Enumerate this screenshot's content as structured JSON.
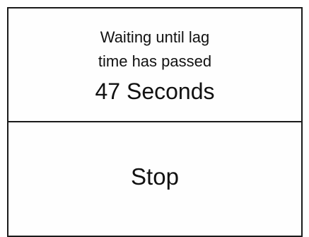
{
  "status": {
    "line1": "Waiting until lag",
    "line2": "time has passed",
    "countdown": "47 Seconds"
  },
  "actions": {
    "stop_label": "Stop"
  },
  "colors": {
    "border": "#1a1a1a",
    "background": "#ffffff",
    "text": "#111111"
  }
}
